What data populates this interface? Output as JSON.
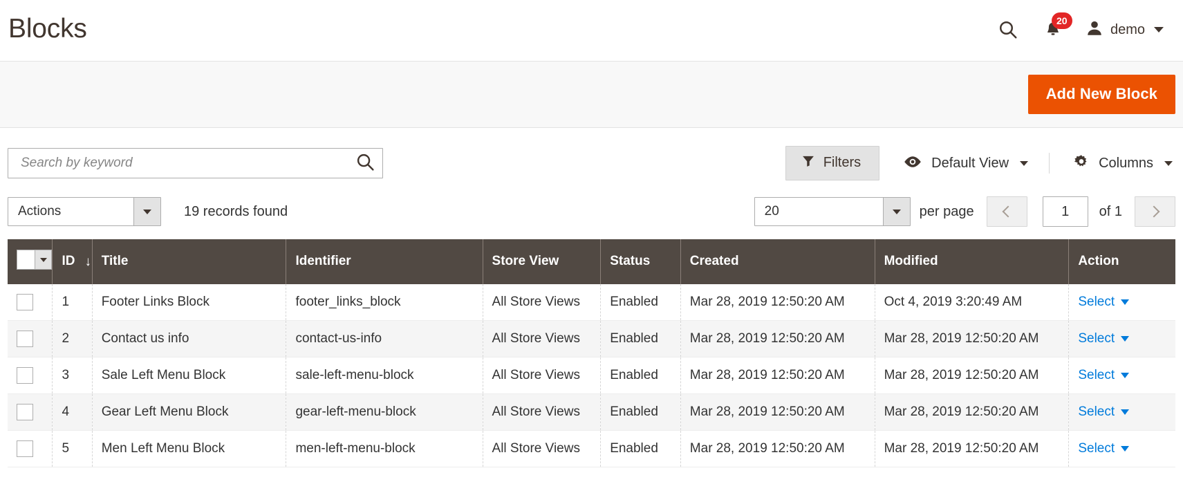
{
  "header": {
    "title": "Blocks",
    "search_icon": "search-icon",
    "notifications": {
      "icon": "bell-icon",
      "count": "20"
    },
    "user": {
      "avatar_icon": "user-avatar-icon",
      "name": "demo",
      "caret": "chevron-down-icon"
    }
  },
  "page_actions": {
    "add_new_block_label": "Add New Block",
    "primary_color": "#eb5202"
  },
  "toolbar": {
    "search": {
      "placeholder": "Search by keyword",
      "value": "",
      "submit_icon": "search-icon"
    },
    "filters_label": "Filters",
    "filters_icon": "funnel-icon",
    "view_icon": "eye-icon",
    "view_label": "Default View",
    "columns_icon": "gear-icon",
    "columns_label": "Columns"
  },
  "subtoolbar": {
    "actions_label": "Actions",
    "records_found": "19 records found",
    "per_page_value": "20",
    "per_page_label": "per page",
    "prev_icon": "chevron-left-icon",
    "next_icon": "chevron-right-icon",
    "current_page": "1",
    "total_pages": "of 1"
  },
  "grid": {
    "header_bg": "#514943",
    "link_color": "#007bdb",
    "columns": [
      {
        "key": "check",
        "label": ""
      },
      {
        "key": "id",
        "label": "ID",
        "sorted": "desc",
        "sort_glyph": "↓"
      },
      {
        "key": "title",
        "label": "Title"
      },
      {
        "key": "identifier",
        "label": "Identifier"
      },
      {
        "key": "store_view",
        "label": "Store View"
      },
      {
        "key": "status",
        "label": "Status"
      },
      {
        "key": "created",
        "label": "Created"
      },
      {
        "key": "modified",
        "label": "Modified"
      },
      {
        "key": "action",
        "label": "Action"
      }
    ],
    "action_label": "Select",
    "rows": [
      {
        "id": "1",
        "title": "Footer Links Block",
        "identifier": "footer_links_block",
        "store_view": "All Store Views",
        "status": "Enabled",
        "created": "Mar 28, 2019 12:50:20 AM",
        "modified": "Oct 4, 2019 3:20:49 AM",
        "action": "Select"
      },
      {
        "id": "2",
        "title": "Contact us info",
        "identifier": "contact-us-info",
        "store_view": "All Store Views",
        "status": "Enabled",
        "created": "Mar 28, 2019 12:50:20 AM",
        "modified": "Mar 28, 2019 12:50:20 AM",
        "action": "Select"
      },
      {
        "id": "3",
        "title": "Sale Left Menu Block",
        "identifier": "sale-left-menu-block",
        "store_view": "All Store Views",
        "status": "Enabled",
        "created": "Mar 28, 2019 12:50:20 AM",
        "modified": "Mar 28, 2019 12:50:20 AM",
        "action": "Select"
      },
      {
        "id": "4",
        "title": "Gear Left Menu Block",
        "identifier": "gear-left-menu-block",
        "store_view": "All Store Views",
        "status": "Enabled",
        "created": "Mar 28, 2019 12:50:20 AM",
        "modified": "Mar 28, 2019 12:50:20 AM",
        "action": "Select"
      },
      {
        "id": "5",
        "title": "Men Left Menu Block",
        "identifier": "men-left-menu-block",
        "store_view": "All Store Views",
        "status": "Enabled",
        "created": "Mar 28, 2019 12:50:20 AM",
        "modified": "Mar 28, 2019 12:50:20 AM",
        "action": "Select"
      }
    ]
  }
}
